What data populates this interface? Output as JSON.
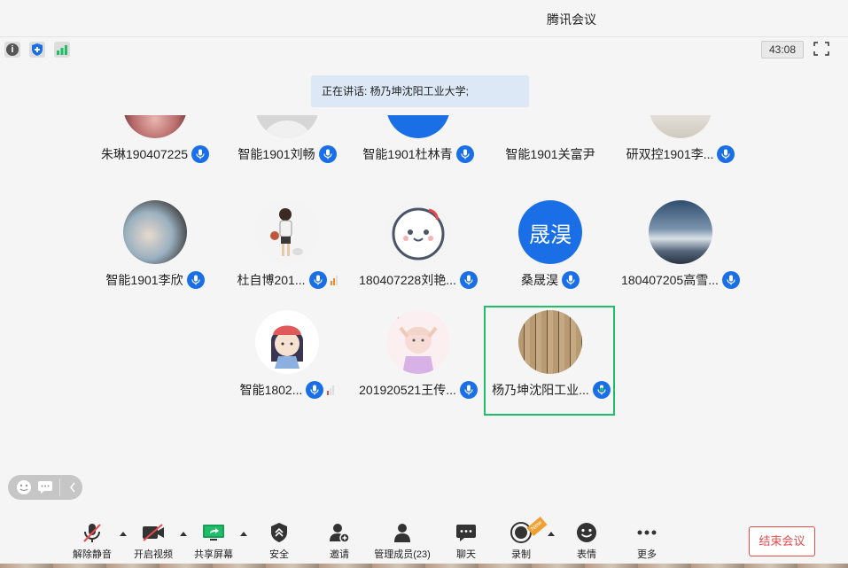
{
  "window": {
    "title": "腾讯会议"
  },
  "status": {
    "timer": "43:08"
  },
  "speaking_label": "正在讲话: 杨乃坤沈阳工业大学;",
  "participants": [
    {
      "name": "朱琳190407225",
      "mic": "on"
    },
    {
      "name": "智能1901刘畅",
      "mic": "on"
    },
    {
      "name": "智能1901杜林青",
      "mic": "on"
    },
    {
      "name": "智能1901关富尹",
      "mic": "none"
    },
    {
      "name": "研双控1901李...",
      "mic": "on"
    },
    {
      "name": "智能1901李欣",
      "mic": "on"
    },
    {
      "name": "杜自博201...",
      "mic": "on",
      "signal": "weak"
    },
    {
      "name": "180407228刘艳...",
      "mic": "on"
    },
    {
      "name": "桑晟淏",
      "mic": "on",
      "avatar_text": "晟淏"
    },
    {
      "name": "180407205高雪...",
      "mic": "on"
    },
    {
      "name": "智能1802...",
      "mic": "on",
      "signal": "weak"
    },
    {
      "name": "201920521王传...",
      "mic": "on"
    },
    {
      "name": "杨乃坤沈阳工业...",
      "mic": "speaking",
      "active": true
    }
  ],
  "toolbar": {
    "unmute": "解除静音",
    "video": "开启视频",
    "share": "共享屏幕",
    "security": "安全",
    "invite": "邀请",
    "members": "管理成员(23)",
    "chat": "聊天",
    "record": "录制",
    "new_badge": "New",
    "reactions": "表情",
    "more": "更多",
    "end": "结束会议"
  },
  "colors": {
    "accent": "#1a6fe6",
    "speaking": "#1fbe69",
    "end": "#e84b4b"
  }
}
